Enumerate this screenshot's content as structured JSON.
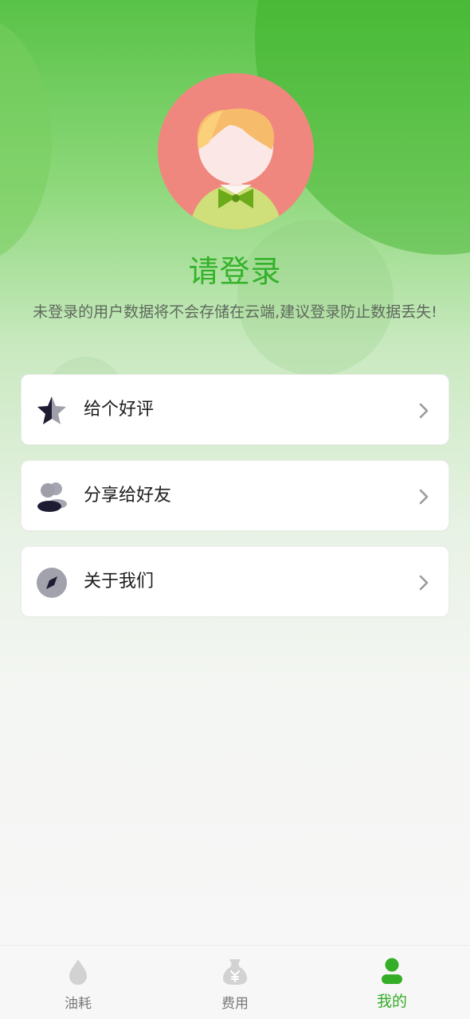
{
  "profile": {
    "title": "请登录",
    "description": "未登录的用户数据将不会存储在云端,建议登录防止数据丢失!"
  },
  "menu": [
    {
      "label": "给个好评",
      "icon": "star-icon"
    },
    {
      "label": "分享给好友",
      "icon": "users-icon"
    },
    {
      "label": "关于我们",
      "icon": "compass-icon"
    }
  ],
  "tabbar": {
    "active": "我的",
    "tabs": [
      {
        "label": "油耗",
        "icon": "droplet-icon"
      },
      {
        "label": "费用",
        "icon": "money-bag-icon"
      },
      {
        "label": "我的",
        "icon": "user-icon"
      }
    ]
  },
  "colors": {
    "accent": "#35b22b",
    "avatar_bg": "#f0877e",
    "inactive": "#7a7a7a"
  }
}
